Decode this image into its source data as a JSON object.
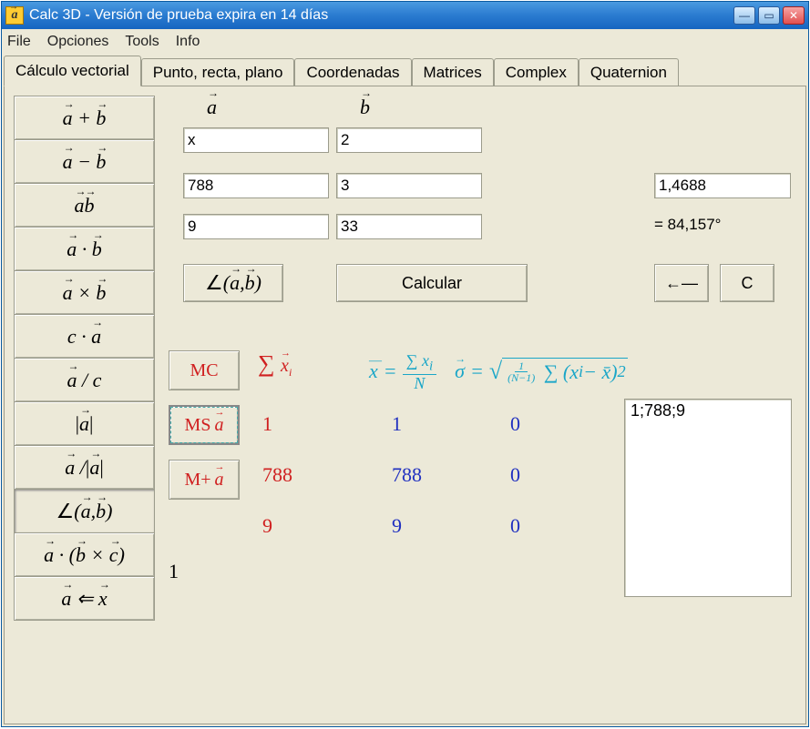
{
  "window": {
    "title": "Calc 3D - Versión de prueba expira en 14 días",
    "app_icon_glyph": "a"
  },
  "menubar": {
    "file": "File",
    "opciones": "Opciones",
    "tools": "Tools",
    "info": "Info"
  },
  "tabs": {
    "vectorial": "Cálculo vectorial",
    "punto": "Punto, recta, plano",
    "coord": "Coordenadas",
    "matrices": "Matrices",
    "complex": "Complex",
    "quaternion": "Quaternion"
  },
  "ops": {
    "add": "a + b",
    "sub": "a − b",
    "ab": "ab",
    "dot": "a · b",
    "cross": "a × b",
    "scalar": "c · a",
    "div": "a / c",
    "abs": "a",
    "normalize": "a /|a|",
    "angle": "∠(a, b)",
    "triple": "a · (b × c)",
    "assign": "a ⇐ x"
  },
  "headers": {
    "a": "a",
    "b": "b"
  },
  "vector_a": {
    "x": "x",
    "y": "788",
    "z": "9"
  },
  "vector_b": {
    "x": "2",
    "y": "3",
    "z": "33"
  },
  "result": {
    "value": "1,4688",
    "deg": "= 84,157°"
  },
  "buttons": {
    "angle_op": "∠(a, b)",
    "calcular": "Calcular",
    "back": "←—",
    "clear": "C",
    "mc": "MC",
    "ms": "MS",
    "mplus": "M+"
  },
  "stats": {
    "col_red": [
      "1",
      "788",
      "9"
    ],
    "col_blue1": [
      "1",
      "788",
      "9"
    ],
    "col_blue2": [
      "0",
      "0",
      "0"
    ],
    "n": "1"
  },
  "listbox": {
    "item0": "1;788;9"
  }
}
